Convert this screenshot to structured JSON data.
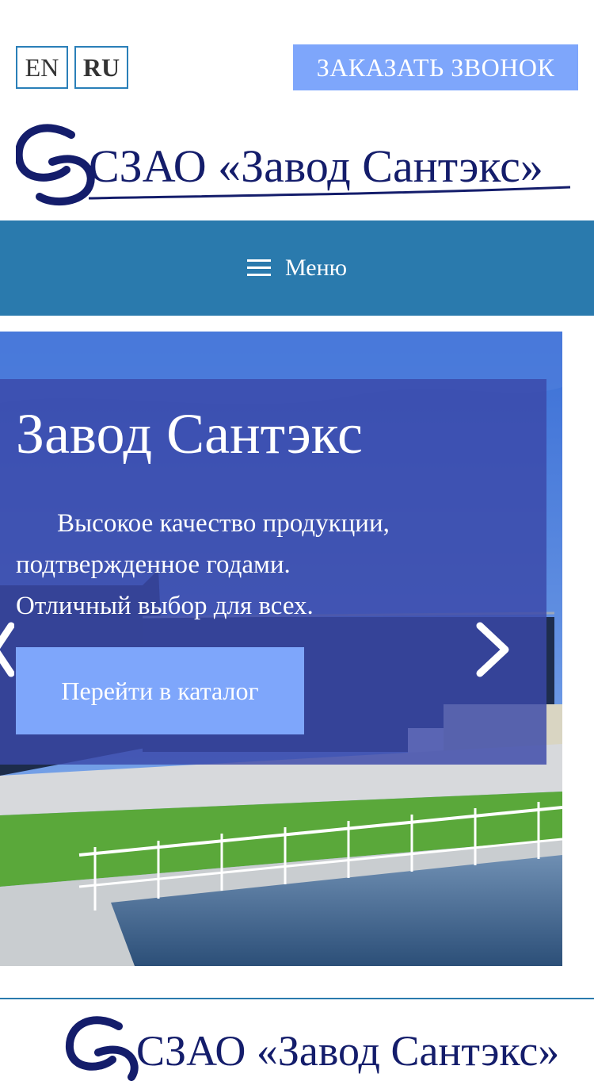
{
  "header": {
    "lang_en": "EN",
    "lang_ru": "RU",
    "callback_label": "ЗАКАЗАТЬ ЗВОНОК"
  },
  "logo": {
    "text": "СЗАО «Завод Сантэкс»"
  },
  "nav": {
    "menu_label": "Меню"
  },
  "hero": {
    "title": "Завод Сантэкс",
    "line1": "Высокое качество продукции,",
    "line2": "подтвержденное годами.",
    "line3": "Отличный выбор для всех.",
    "cta_label": "Перейти в каталог"
  },
  "footer": {
    "logo_text": "СЗАО «Завод Сантэкс»"
  },
  "colors": {
    "accent": "#7ea6fb",
    "nav_bg": "#2a7aad",
    "logo_blue": "#141d6b",
    "overlay": "#3a48a8"
  }
}
